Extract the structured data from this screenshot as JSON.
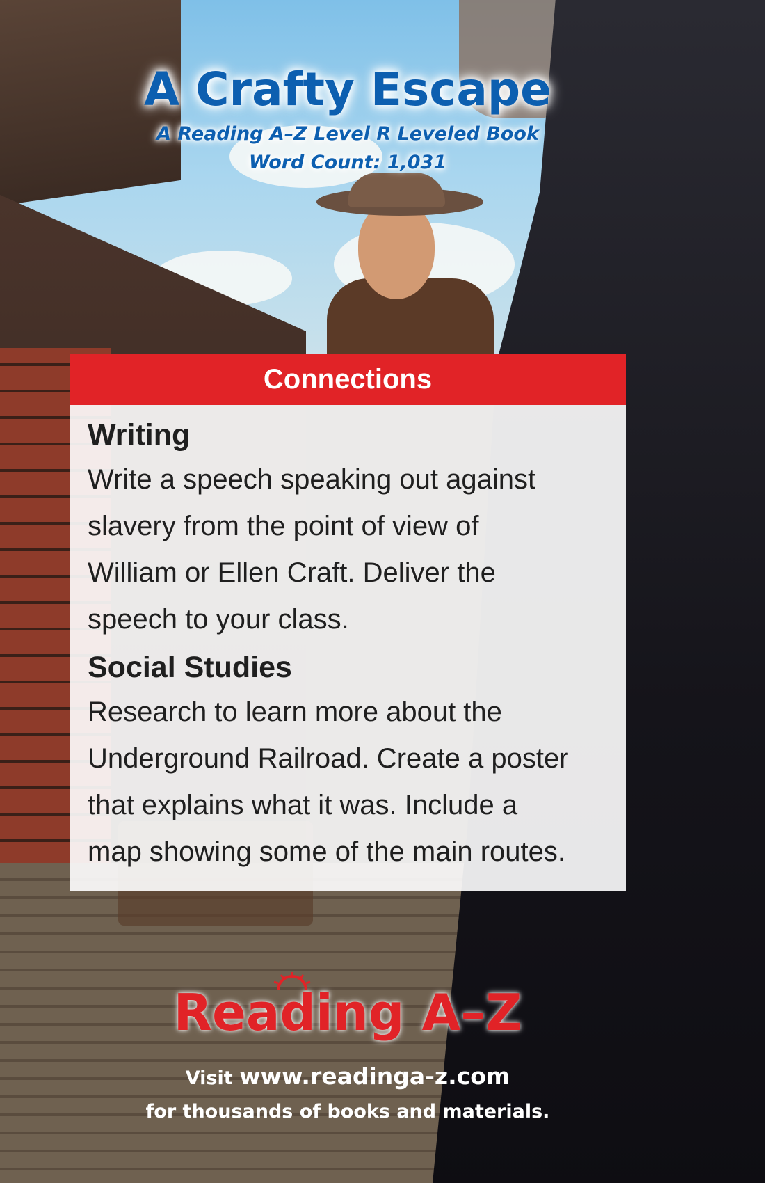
{
  "cover": {
    "title": "A Crafty Escape",
    "subtitle": "A Reading A–Z Level R Leveled Book",
    "word_count": "Word Count: 1,031"
  },
  "connections": {
    "header": "Connections",
    "sections": [
      {
        "heading": "Writing",
        "lines": [
          "Write a speech speaking out against",
          "slavery from the point of view of",
          "William or Ellen Craft. Deliver the",
          "speech to your class."
        ]
      },
      {
        "heading": "Social Studies",
        "lines": [
          "Research to learn more about the",
          "Underground Railroad. Create a poster",
          "that explains what it was. Include a",
          "map showing some of the main routes."
        ]
      }
    ]
  },
  "footer": {
    "logo_text": "Reading A–Z",
    "visit_prefix": "Visit",
    "url": "www.readinga-z.com",
    "tagline": "for thousands of books and materials."
  },
  "colors": {
    "title_blue": "#0d5fb0",
    "header_red": "#e12327",
    "logo_red": "#e12327"
  }
}
